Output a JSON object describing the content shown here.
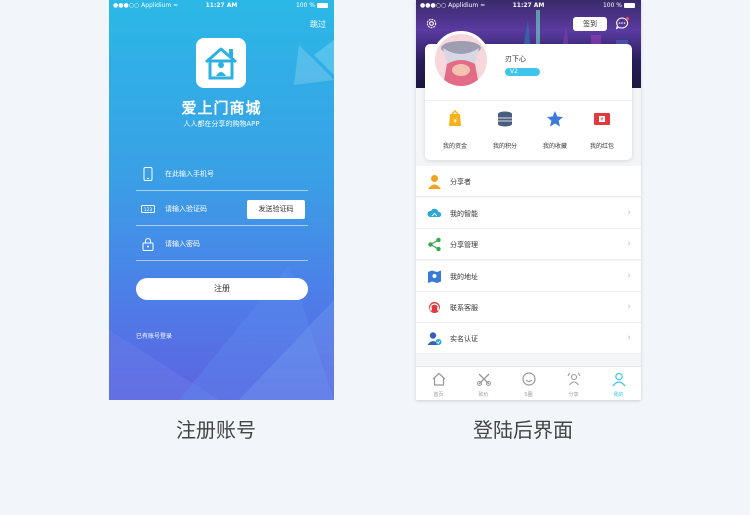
{
  "left_screen": {
    "status": {
      "carrier": "●●●○○ Applidium ≈",
      "time": "11:27 AM",
      "battery": "100 %"
    },
    "skip": "跳过",
    "brand_title": "爱上门商城",
    "brand_subtitle": "人人都在分享的购物APP",
    "phone_placeholder": "在此输入手机号",
    "code_placeholder": "请输入验证码",
    "send_code_button": "发送验证码",
    "password_placeholder": "请输入密码",
    "register_button": "注册",
    "login_link": "已有账号登录"
  },
  "right_screen": {
    "status": {
      "carrier": "●●●○○ Applidium ≈",
      "time": "11:27 AM",
      "battery": "100 %"
    },
    "checkin_button": "签到",
    "username": "刃下心",
    "vip_label": "V2",
    "quick_actions": [
      {
        "label": "我的资金",
        "icon": "wallet-icon",
        "color": "#f3b21b"
      },
      {
        "label": "我的积分",
        "icon": "coins-icon",
        "color": "#4a5d7e"
      },
      {
        "label": "我的收藏",
        "icon": "star-icon",
        "color": "#3a7ad9"
      },
      {
        "label": "我的红包",
        "icon": "red-envelope-icon",
        "color": "#e0393e"
      }
    ],
    "menu": [
      {
        "label": "分享者",
        "icon": "sharer-icon",
        "chevron": false
      },
      {
        "label": "我的智能",
        "icon": "cloud-icon",
        "chevron": true
      },
      {
        "label": "分享管理",
        "icon": "share-icon",
        "chevron": true
      },
      {
        "label": "我的地址",
        "icon": "map-icon",
        "chevron": true
      },
      {
        "label": "联系客服",
        "icon": "headset-icon",
        "chevron": true
      },
      {
        "label": "实名认证",
        "icon": "verify-icon",
        "chevron": true
      }
    ],
    "chevron": "›",
    "tabs": [
      {
        "label": "首页",
        "icon": "home-icon",
        "active": false
      },
      {
        "label": "砍价",
        "icon": "bargain-icon",
        "active": false
      },
      {
        "label": "S圈",
        "icon": "circle-icon",
        "active": false
      },
      {
        "label": "分享",
        "icon": "share-tab-icon",
        "active": false
      },
      {
        "label": "我的",
        "icon": "profile-icon",
        "active": true
      }
    ]
  },
  "captions": {
    "left": "注册账号",
    "right": "登陆后界面"
  },
  "colors": {
    "accent": "#3fc4ea",
    "left_gradient_top": "#2bb8e6",
    "left_gradient_bottom": "#5d63e0"
  }
}
